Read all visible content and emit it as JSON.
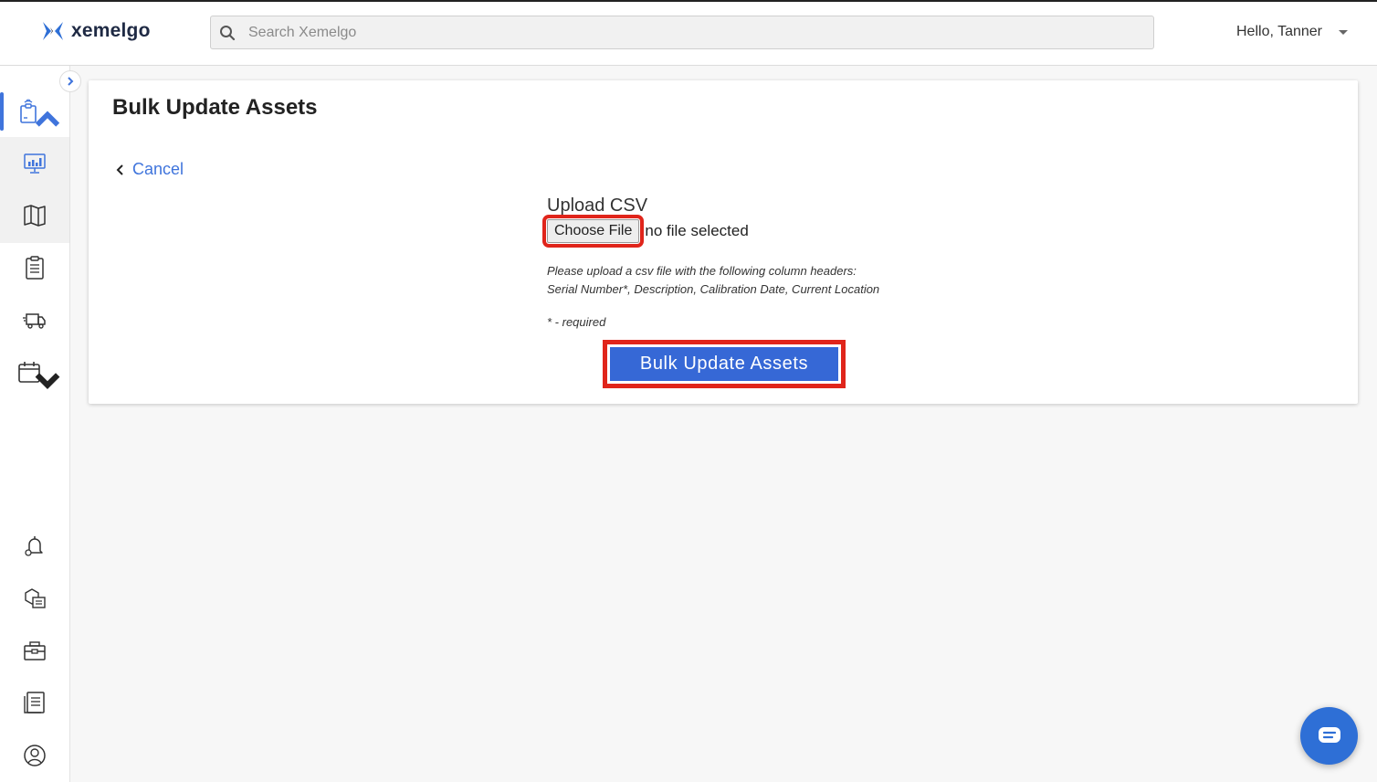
{
  "app": {
    "logo_text": "xemelgo",
    "brand_color": "#1f2a44",
    "accent_color": "#3f74dc"
  },
  "header": {
    "search_placeholder": "Search Xemelgo",
    "user_greeting": "Hello, Tanner"
  },
  "sidebar": {
    "items": [
      {
        "icon": "asset-tag-icon",
        "active": true
      },
      {
        "icon": "dashboard-chart-icon"
      },
      {
        "icon": "map-icon"
      },
      {
        "icon": "clipboard-checklist-icon"
      },
      {
        "icon": "shipment-truck-icon"
      },
      {
        "icon": "calendar-icon"
      },
      {
        "icon": "alert-bell-settings-icon"
      },
      {
        "icon": "inventory-list-icon"
      },
      {
        "icon": "toolbox-icon"
      },
      {
        "icon": "report-document-icon"
      },
      {
        "icon": "user-profile-icon"
      }
    ]
  },
  "main": {
    "title": "Bulk Update Assets",
    "cancel_label": "Cancel",
    "upload_label": "Upload CSV",
    "choose_file_label": "Choose File",
    "file_status": "no file selected",
    "hint_line1": "Please upload a csv file with the following column headers:",
    "hint_line2": "Serial Number*, Description, Calibration Date, Current Location",
    "required_note": "* - required",
    "submit_label": "Bulk Update Assets"
  }
}
